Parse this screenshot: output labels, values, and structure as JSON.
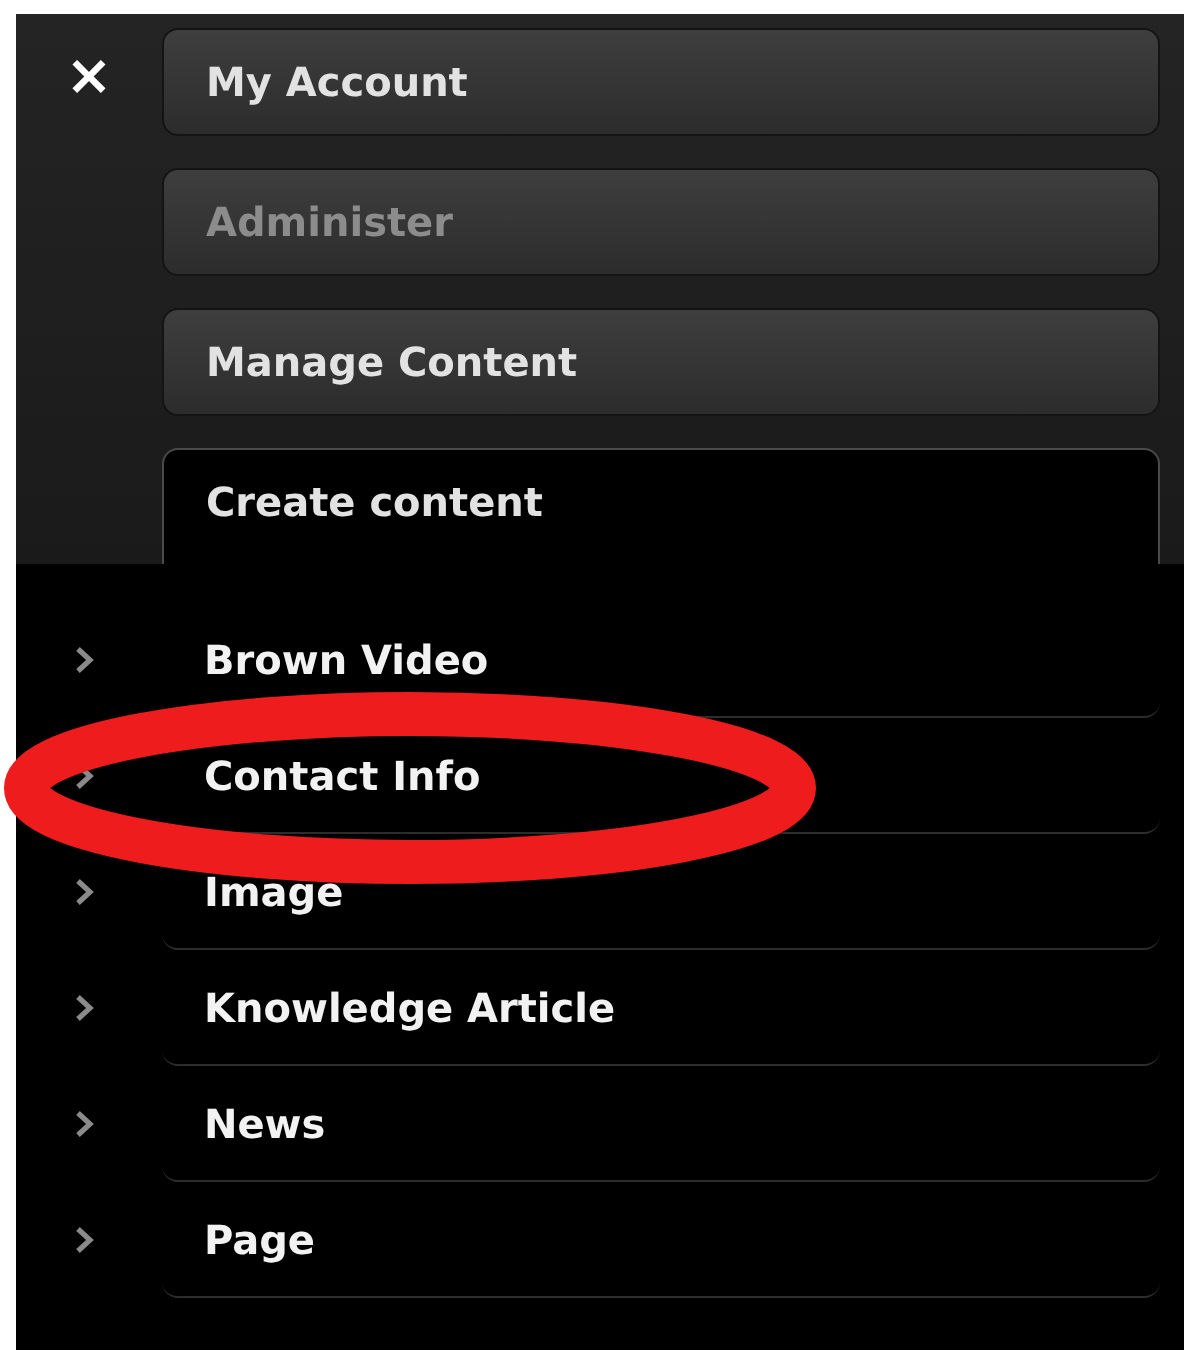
{
  "close_button": "×",
  "tabs": [
    {
      "label": "My Account",
      "selected": false,
      "disabled": false
    },
    {
      "label": "Administer",
      "selected": false,
      "disabled": true
    },
    {
      "label": "Manage Content",
      "selected": false,
      "disabled": false
    },
    {
      "label": "Create content",
      "selected": true,
      "disabled": false
    }
  ],
  "content_types": [
    {
      "label": "Brown Video",
      "circled": false
    },
    {
      "label": "Contact Info",
      "circled": true
    },
    {
      "label": "Image",
      "circled": false
    },
    {
      "label": "Knowledge Article",
      "circled": false
    },
    {
      "label": "News",
      "circled": false
    },
    {
      "label": "Page",
      "circled": false
    }
  ]
}
